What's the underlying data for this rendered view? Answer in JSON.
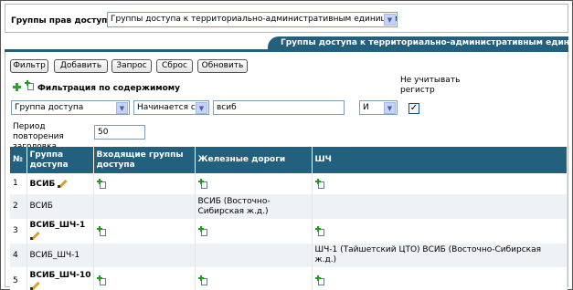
{
  "header": {
    "group_label": "Группы прав доступа:",
    "group_selected": "Группы доступа к территориально-административным единицам РЖД"
  },
  "tab": {
    "title": "Группы доступа к территориально-административным единицам"
  },
  "toolbar": {
    "filter": "Фильтр",
    "add": "Добавить",
    "query": "Запрос",
    "reset": "Сброс",
    "refresh": "Обновить"
  },
  "filter": {
    "title": "Фильтрация по содержимому",
    "field": "Группа доступа",
    "operator": "Начинается с",
    "value": "всиб",
    "logic": "И",
    "ignore_case_label": "Не учитывать регистр",
    "ignore_case_checked": "✓"
  },
  "period": {
    "label": "Период повторения заголовка таблицы",
    "value": "50"
  },
  "table": {
    "headers": [
      "№",
      "Группа доступа",
      "Входящие группы доступа",
      "Железные дороги",
      "ШЧ"
    ],
    "rows": [
      {
        "num": "1",
        "group": "ВСИБ",
        "incoming": "",
        "railways": "",
        "shch": "",
        "editable": true
      },
      {
        "num": "2",
        "group": "ВСИБ",
        "incoming": "",
        "railways": "ВСИБ (Восточно-Сибирская ж.д.)",
        "shch": "",
        "editable": false
      },
      {
        "num": "3",
        "group": "ВСИБ_ШЧ-1",
        "incoming": "",
        "railways": "",
        "shch": "",
        "editable": true
      },
      {
        "num": "4",
        "group": "ВСИБ_ШЧ-1",
        "incoming": "",
        "railways": "",
        "shch": "ШЧ-1 (Тайшетский ЦТО) ВСИБ (Восточно-Сибирская ж.д.)",
        "editable": false
      },
      {
        "num": "5",
        "group": "ВСИБ_ШЧ-10",
        "incoming": "",
        "railways": "",
        "shch": "",
        "editable": true
      }
    ]
  },
  "colors": {
    "header_bg": "#23607e",
    "even_row": "#eef2f5"
  }
}
